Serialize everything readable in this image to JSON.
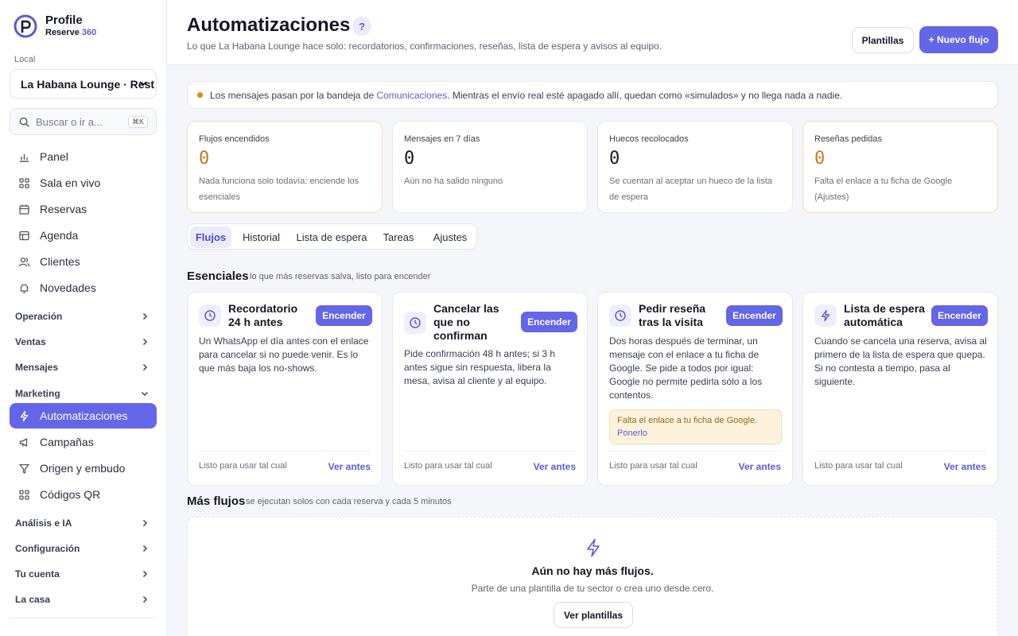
{
  "brand": {
    "name": "Profile",
    "sub": "Reserve",
    "sub_accent": "360"
  },
  "sidebar": {
    "local_label": "Local",
    "local_value": "La Habana Lounge · Rest",
    "search_placeholder": "Buscar o ir a...",
    "search_shortcut": "⌘K",
    "nav": [
      {
        "label": "Panel",
        "icon": "chart-icon"
      },
      {
        "label": "Sala en vivo",
        "icon": "grid-icon"
      },
      {
        "label": "Reservas",
        "icon": "calendar-icon"
      },
      {
        "label": "Agenda",
        "icon": "table-icon"
      },
      {
        "label": "Clientes",
        "icon": "users-icon"
      },
      {
        "label": "Novedades",
        "icon": "bell-icon"
      }
    ],
    "groups": {
      "operacion": "Operación",
      "ventas": "Ventas",
      "mensajes": "Mensajes",
      "marketing": "Marketing",
      "analisis": "Análisis e IA",
      "configuracion": "Configuración",
      "cuenta": "Tu cuenta",
      "casa": "La casa"
    },
    "marketing_items": [
      {
        "label": "Automatizaciones",
        "icon": "bolt-icon",
        "active": true
      },
      {
        "label": "Campañas",
        "icon": "megaphone-icon"
      },
      {
        "label": "Origen y embudo",
        "icon": "funnel-icon"
      },
      {
        "label": "Códigos QR",
        "icon": "qr-icon"
      }
    ]
  },
  "header": {
    "title": "Automatizaciones",
    "help": "?",
    "subtitle": "Lo que La Habana Lounge hace solo: recordatorios, confirmaciones, reseñas, lista de espera y avisos al equipo.",
    "templates_button": "Plantillas",
    "new_flow_button": "+ Nuevo flujo"
  },
  "notice": {
    "before": "Los mensajes pasan por la bandeja de ",
    "link": "Comunicaciones",
    "after": ". Mientras el envío real esté apagado allí, quedan como «simulados» y no llega nada a nadie."
  },
  "stats": [
    {
      "label": "Flujos encendidos",
      "value": "0",
      "note": "Nada funciona solo todavía: enciende los esenciales"
    },
    {
      "label": "Mensajes en 7 días",
      "value": "0",
      "note": "Aún no ha salido ninguno"
    },
    {
      "label": "Huecos recolocados",
      "value": "0",
      "note": "Se cuentan al aceptar un hueco de la lista de espera"
    },
    {
      "label": "Reseñas pedidas",
      "value": "0",
      "note": "Falta el enlace a tu ficha de Google (Ajustes)"
    }
  ],
  "tabs": [
    "Flujos",
    "Historial",
    "Lista de espera",
    "Tareas",
    "Ajustes"
  ],
  "essentials": {
    "title": "Esenciales",
    "subtitle": "lo que más reservas salva, listo para encender",
    "cards": [
      {
        "title": "Recordatorio 24 h antes",
        "button": "Encender",
        "desc": "Un WhatsApp el día antes con el enlace para cancelar si no puede venir. Es lo que más baja los no-shows.",
        "status": "Listo para usar tal cual",
        "preview": "Ver antes"
      },
      {
        "title": "Cancelar las que no confirman",
        "button": "Encender",
        "desc": "Pide confirmación 48 h antes; si 3 h antes sigue sin respuesta, libera la mesa, avisa al cliente y al equipo.",
        "status": "Listo para usar tal cual",
        "preview": "Ver antes"
      },
      {
        "title": "Pedir reseña tras la visita",
        "button": "Encender",
        "desc": "Dos horas después de terminar, un mensaje con el enlace a tu ficha de Google. Se pide a todos por igual: Google no permite pedirla sólo a los contentos.",
        "warning": "Falta el enlace a tu ficha de Google.",
        "warning_link": "Ponerlo",
        "status": "Listo para usar tal cual",
        "preview": "Ver antes"
      },
      {
        "title": "Lista de espera automática",
        "button": "Encender",
        "desc": "Cuando se cancela una reserva, avisa al primero de la lista de espera que quepa. Si no contesta a tiempo, pasa al siguiente.",
        "status": "Listo para usar tal cual",
        "preview": "Ver antes"
      }
    ]
  },
  "more_flows": {
    "title": "Más flujos",
    "subtitle": "se ejecutan solos con cada reserva y cada 5 minutos",
    "empty_title": "Aún no hay más flujos.",
    "empty_sub": "Parte de una plantilla de tu sector o crea uno desde cero.",
    "empty_button": "Ver plantillas"
  },
  "colors": {
    "accent": "#6366e8",
    "warning": "#e8850c",
    "warning_value": "#c6791a"
  }
}
